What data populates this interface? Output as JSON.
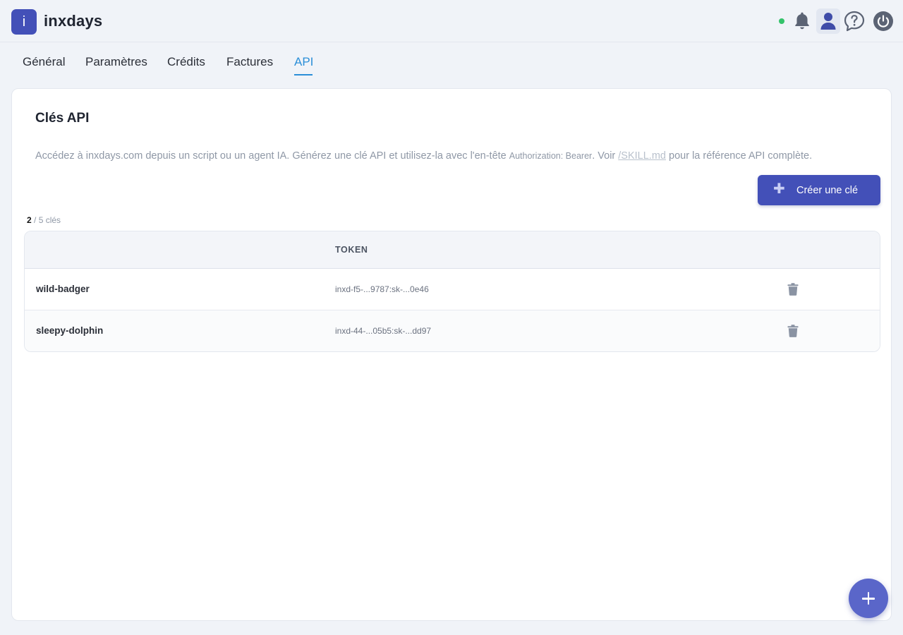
{
  "app": {
    "logo_letter": "i",
    "name": "inxdays"
  },
  "header": {
    "icons": [
      "bell-icon",
      "user-icon",
      "help-icon",
      "power-icon"
    ],
    "status_color": "#34c36b"
  },
  "tabs": [
    {
      "label": "Général"
    },
    {
      "label": "Paramètres"
    },
    {
      "label": "Crédits"
    },
    {
      "label": "Factures"
    },
    {
      "label": "API",
      "active": true
    }
  ],
  "card": {
    "title": "Clés API",
    "description": {
      "part1": "Accédez à inxdays.com depuis un script ou un agent IA. Générez une clé API et utilisez-la avec l'en-tête ",
      "code": "Authorization: Bearer",
      "part2": ". Voir ",
      "link": "/SKILL.md",
      "part3": " pour la référence API complète."
    },
    "create_button": "Créer une clé",
    "count": {
      "current": "2",
      "rest": " / 5 clés"
    }
  },
  "table": {
    "columns": [
      "",
      "TOKEN",
      ""
    ],
    "rows": [
      {
        "name": "wild-badger",
        "token": "inxd-f5-...9787:sk-...0e46"
      },
      {
        "name": "sleepy-dolphin",
        "token": "inxd-44-...05b5:sk-...dd97"
      }
    ]
  },
  "colors": {
    "accent": "#4350b8",
    "tab_active": "#2b8fd8",
    "fab": "#5a66c9"
  }
}
